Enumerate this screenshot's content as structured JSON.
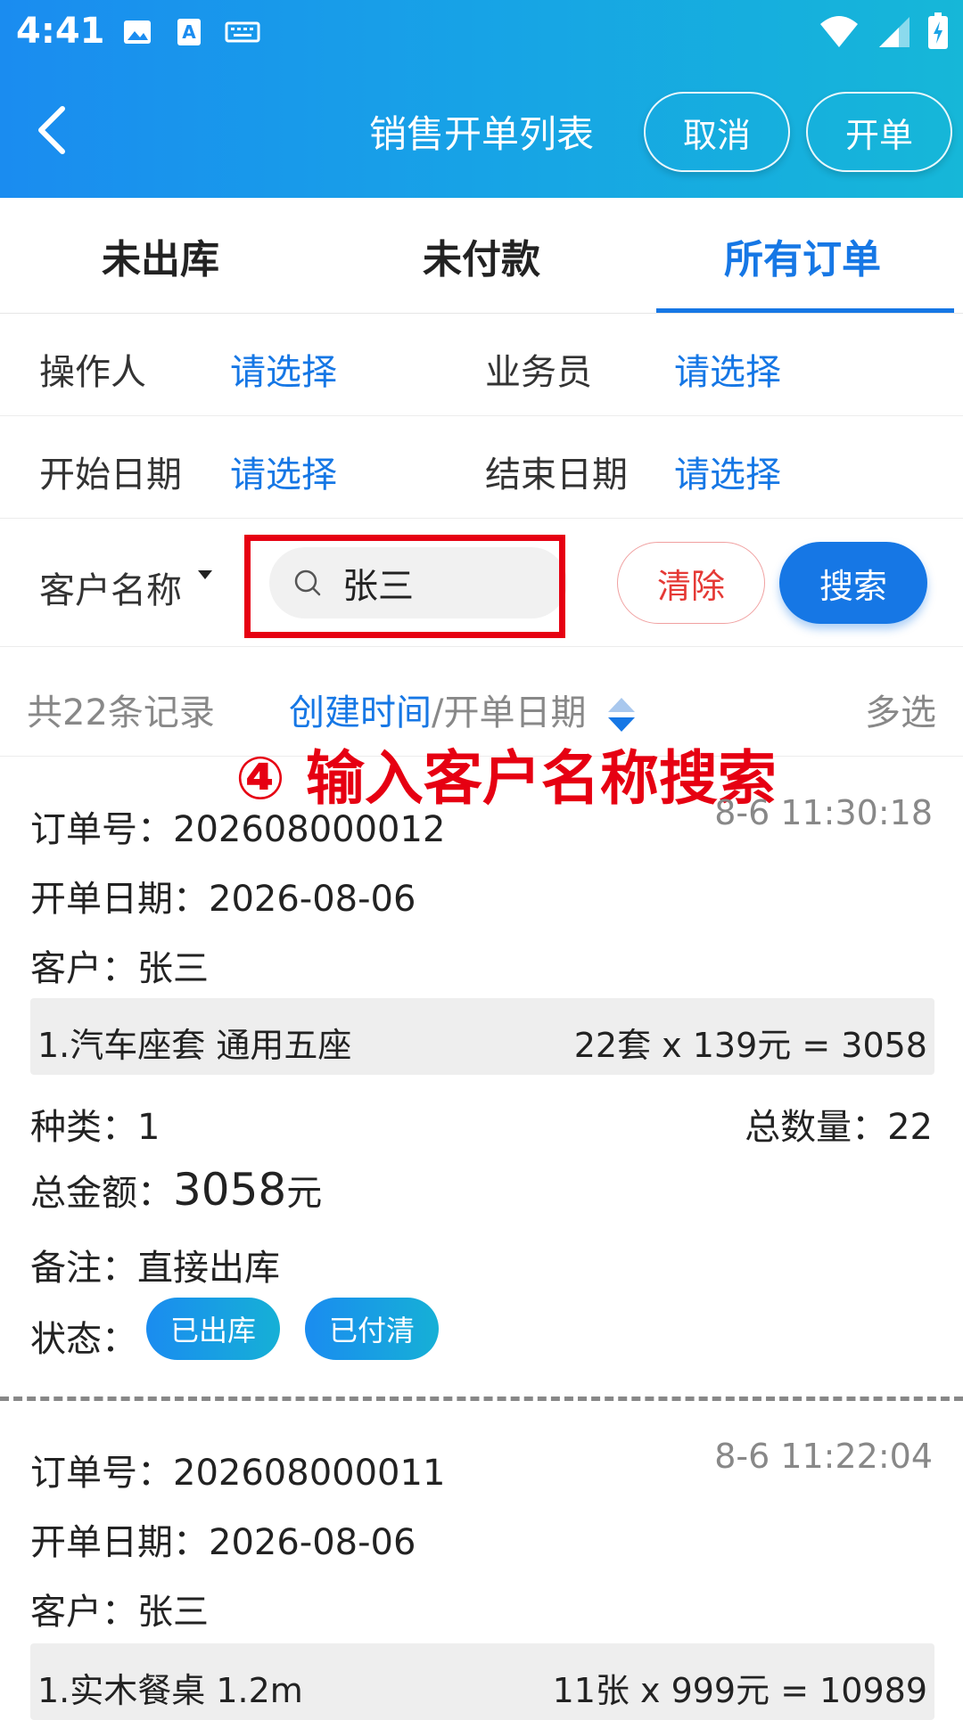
{
  "status_bar": {
    "time": "4:41"
  },
  "header": {
    "title": "销售开单列表",
    "cancel_label": "取消",
    "create_label": "开单"
  },
  "tabs": [
    {
      "label": "未出库",
      "active": false
    },
    {
      "label": "未付款",
      "active": false
    },
    {
      "label": "所有订单",
      "active": true
    }
  ],
  "filters": {
    "operator_label": "操作人",
    "operator_value": "请选择",
    "salesman_label": "业务员",
    "salesman_value": "请选择",
    "start_label": "开始日期",
    "start_value": "请选择",
    "end_label": "结束日期",
    "end_value": "请选择"
  },
  "search": {
    "field_label": "客户名称",
    "value": "张三",
    "clear_label": "清除",
    "search_label": "搜索"
  },
  "summary": {
    "count_text": "共22条记录",
    "sort_active": "创建时间",
    "sort_sep": "/",
    "sort_other": "开单日期",
    "multi_select": "多选"
  },
  "annotation": "④ 输入客户名称搜索",
  "orders": [
    {
      "order_no": "订单号：202608000012",
      "time": "8-6 11:30:18",
      "date": "开单日期：2026-08-06",
      "customer": "客户：张三",
      "item_name": "1.汽车座套 通用五座",
      "item_calc": "22套 x 139元 = 3058",
      "kinds": "种类：1",
      "total_qty": "总数量：22",
      "amount_label": "总金额：",
      "amount_value": "3058",
      "amount_unit": "元",
      "note": "备注：直接出库",
      "status_label": "状态：",
      "badge1": "已出库",
      "badge2": "已付清"
    },
    {
      "order_no": "订单号：202608000011",
      "time": "8-6 11:22:04",
      "date": "开单日期：2026-08-06",
      "customer": "客户：张三",
      "item_name": "1.实木餐桌 1.2m",
      "item_calc": "11张 x 999元 = 10989"
    }
  ],
  "colors": {
    "accent": "#1677e5",
    "danger": "#e60012",
    "header_start": "#1a8cf0",
    "header_end": "#16b7d8"
  }
}
